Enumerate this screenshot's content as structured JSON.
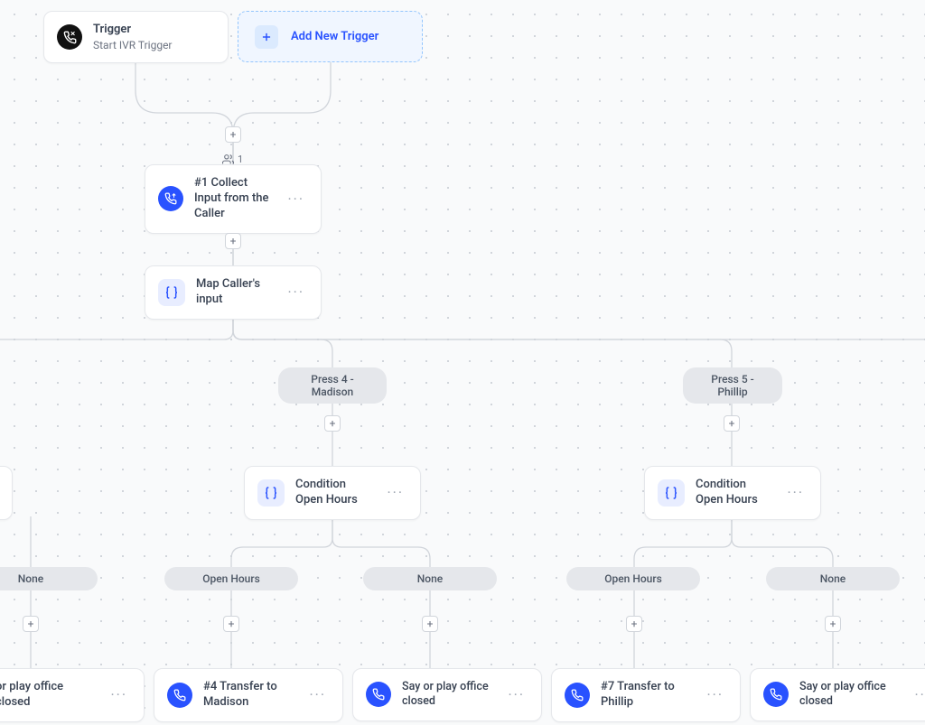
{
  "trigger": {
    "title": "Trigger",
    "subtitle": "Start IVR Trigger"
  },
  "addTrigger": {
    "label": "Add New Trigger"
  },
  "collectInput": {
    "label": "#1 Collect Input from the Caller",
    "counter": "1"
  },
  "mapInput": {
    "label": "Map Caller's input"
  },
  "branches": {
    "press4": {
      "label": "Press 4 - Madison"
    },
    "press5": {
      "label": "Press 5 - Phillip"
    }
  },
  "condition": {
    "label": "Condition Open Hours"
  },
  "outcomes": {
    "openHours": "Open Hours",
    "none": "None"
  },
  "actions": {
    "transferMadison": "#4 Transfer to Madison",
    "transferPhillip": "#7 Transfer to Phillip",
    "sayClosed": "Say or play office closed",
    "orPlayClosed": "or play office closed"
  }
}
